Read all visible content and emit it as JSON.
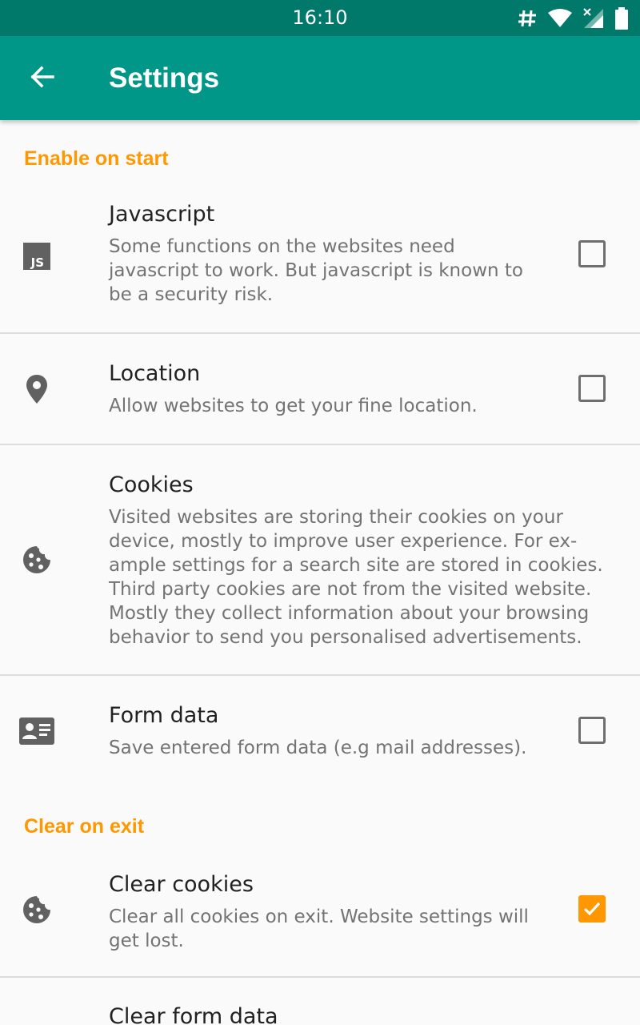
{
  "status_bar": {
    "time": "16:10",
    "icons": [
      "hashtag-icon",
      "wifi-icon",
      "signal-icon",
      "battery-icon"
    ]
  },
  "app_bar": {
    "title": "Settings",
    "back_icon": "arrow-back-icon",
    "color": "#009688"
  },
  "colors": {
    "accent": "#ff9800",
    "primary_dark": "#00796b"
  },
  "categories": {
    "enable_on_start": "Enable on start",
    "clear_on_exit": "Clear on exit"
  },
  "prefs": {
    "javascript": {
      "icon": "js-icon",
      "title": "Javascript",
      "summary": [
        "Some functions on the websites need",
        "javascript to work. But javascript is known to",
        "be a security risk."
      ],
      "checked": false
    },
    "location": {
      "icon": "location-pin-icon",
      "title": "Location",
      "summary": [
        "Allow websites to get your fine location."
      ],
      "checked": false
    },
    "cookies": {
      "icon": "cookie-icon",
      "title": "Cookies",
      "summary": [
        "Visited websites are storing their cookies on your",
        "device, mostly to improve user experience. For ex-",
        "ample settings for a search site are stored in cookies.",
        "Third party cookies are not from the visited website.",
        "Mostly they collect information about your browsing",
        "behavior to send you personalised advertisements."
      ]
    },
    "form_data": {
      "icon": "id-card-icon",
      "title": "Form data",
      "summary": [
        "Save entered form data (e.g mail addresses)."
      ],
      "checked": false
    },
    "clear_cookies": {
      "icon": "cookie-icon",
      "title": "Clear cookies",
      "summary": [
        "Clear all cookies on exit. Website settings will",
        "get lost."
      ],
      "checked": true
    },
    "clear_form_data": {
      "title": "Clear form data"
    }
  }
}
